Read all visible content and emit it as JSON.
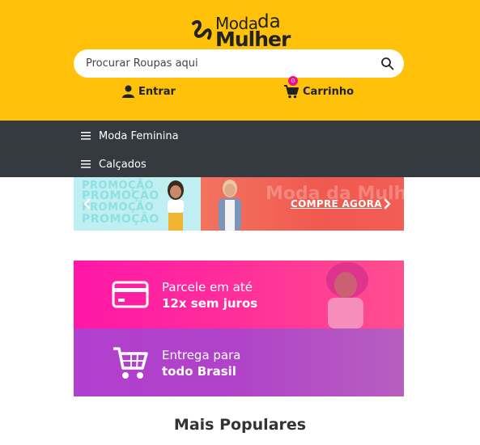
{
  "logo": {
    "word1": "Moda",
    "word2": "da",
    "word3": "Mulher"
  },
  "search": {
    "placeholder": "Procurar Roupas aqui",
    "icon": "search-icon"
  },
  "account": {
    "login_label": "Entrar",
    "cart_label": "Carrinho",
    "cart_count": "0"
  },
  "nav": {
    "items": [
      {
        "label": "Moda Feminina",
        "icon": "menu-icon"
      },
      {
        "label": "Calçados",
        "icon": "menu-icon"
      }
    ]
  },
  "banner": {
    "promo_words": [
      "PROMOÇÃO",
      "PROMOÇÃO",
      "PROMOÇÃO",
      "PROMOÇÃO"
    ],
    "cta": "COMPRE AGORA",
    "watermark": "Moda da Mulher"
  },
  "cards": [
    {
      "line1": "Parcele em até",
      "line2": "12x sem juros",
      "icon": "credit-card-icon"
    },
    {
      "line1": "Entrega para",
      "line2": "todo Brasil",
      "icon": "shopping-cart-icon"
    }
  ],
  "section": {
    "title": "Mais Populares"
  },
  "colors": {
    "header": "#ffc10a",
    "nav": "#343a40",
    "badge": "#e8128c",
    "card_pink": "#ff17a8",
    "card_purple": "#b13fcf"
  }
}
